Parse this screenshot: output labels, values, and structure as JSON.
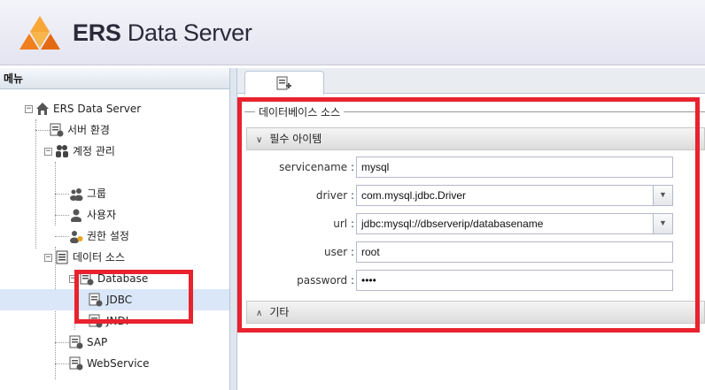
{
  "app": {
    "title_bold": "ERS",
    "title_rest": " Data Server"
  },
  "menu": {
    "header": "메뉴",
    "items": [
      {
        "label": "ERS Data Server",
        "icon": "home-icon"
      },
      {
        "label": "서버 환경",
        "icon": "server-config-icon"
      },
      {
        "label": "계정 관리",
        "icon": "users-icon"
      },
      {
        "label": "그룹",
        "icon": "group-icon"
      },
      {
        "label": "사용자",
        "icon": "user-icon"
      },
      {
        "label": "권한 설정",
        "icon": "permission-icon"
      },
      {
        "label": "데이터 소스",
        "icon": "datasource-icon"
      },
      {
        "label": "Database",
        "icon": "database-icon"
      },
      {
        "label": "JDBC",
        "icon": "jdbc-icon"
      },
      {
        "label": "JNDI",
        "icon": "jndi-icon"
      },
      {
        "label": "SAP",
        "icon": "sap-icon"
      },
      {
        "label": "WebService",
        "icon": "webservice-icon"
      }
    ],
    "toggle_expanded": "−"
  },
  "form": {
    "legend": "데이터베이스 소스",
    "required_section": "필수 아이템",
    "other_section": "기타",
    "fields": {
      "servicename": {
        "label": "servicename :",
        "value": "mysql"
      },
      "driver": {
        "label": "driver :",
        "value": "com.mysql.jdbc.Driver"
      },
      "url": {
        "label": "url :",
        "value": "jdbc:mysql://dbserverip/databasename"
      },
      "user": {
        "label": "user :",
        "value": "root"
      },
      "password": {
        "label": "password :",
        "value": "••••"
      }
    },
    "chevron_down": "∨",
    "chevron_up": "∧",
    "dropdown_arrow": "▼"
  },
  "colors": {
    "annotation_red": "#e8222e",
    "selection": "#d9e7f8",
    "logo_orange": "#f29222"
  }
}
